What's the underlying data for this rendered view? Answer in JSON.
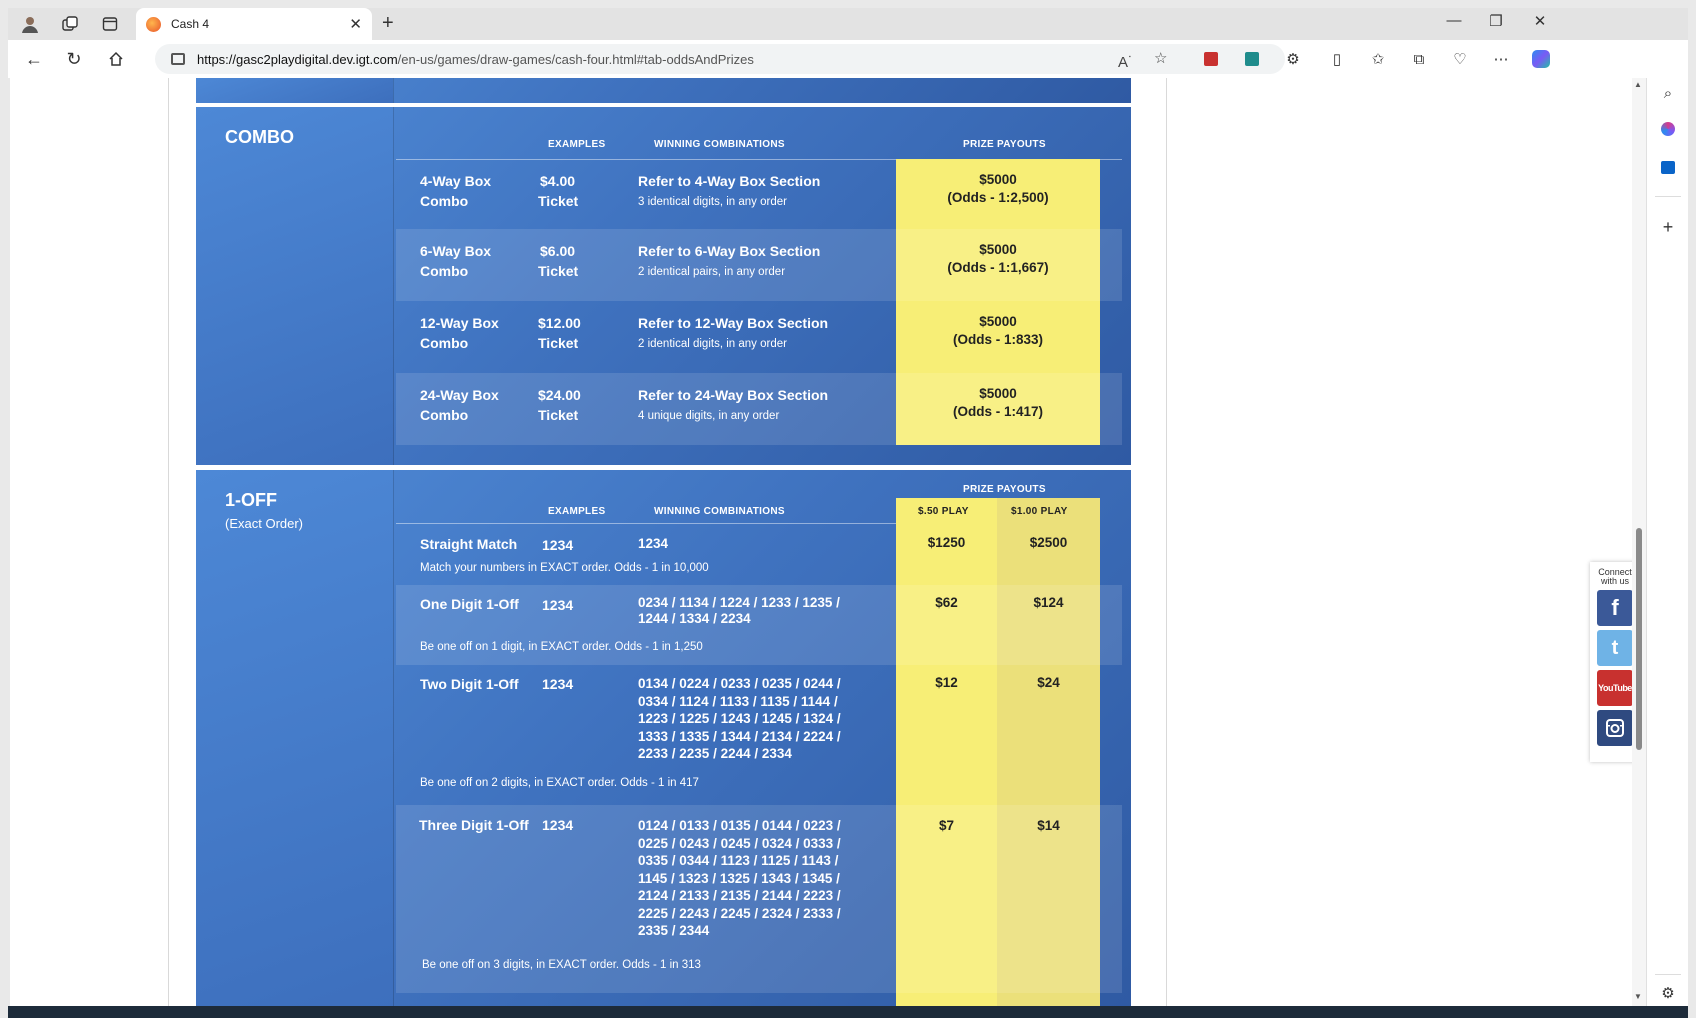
{
  "browser": {
    "tab_title": "Cash 4",
    "url_host": "https://gasc2playdigital.dev.igt.com",
    "url_path": "/en-us/games/draw-games/cash-four.html#tab-oddsAndPrizes"
  },
  "combo": {
    "title": "COMBO",
    "headers": {
      "examples": "EXAMPLES",
      "winning": "WINNING COMBINATIONS",
      "payouts": "PRIZE PAYOUTS"
    },
    "rows": [
      {
        "name1": "4-Way Box",
        "name2": "Combo",
        "ex1": "$4.00",
        "ex2": "Ticket",
        "win": "Refer to 4-Way Box Section",
        "sub": "3 identical digits, in any order",
        "pay1": "$5000",
        "pay2": "(Odds - 1:2,500)"
      },
      {
        "name1": "6-Way Box",
        "name2": "Combo",
        "ex1": "$6.00",
        "ex2": "Ticket",
        "win": "Refer to 6-Way Box Section",
        "sub": "2 identical pairs, in any order",
        "pay1": "$5000",
        "pay2": "(Odds - 1:1,667)"
      },
      {
        "name1": "12-Way Box",
        "name2": "Combo",
        "ex1": "$12.00",
        "ex2": "Ticket",
        "win": "Refer to 12-Way Box Section",
        "sub": "2 identical digits, in any order",
        "pay1": "$5000",
        "pay2": "(Odds - 1:833)"
      },
      {
        "name1": "24-Way Box",
        "name2": "Combo",
        "ex1": "$24.00",
        "ex2": "Ticket",
        "win": "Refer to 24-Way Box Section",
        "sub": "4 unique digits, in any order",
        "pay1": "$5000",
        "pay2": "(Odds - 1:417)"
      }
    ]
  },
  "oneoff": {
    "title": "1-OFF",
    "subtitle": "(Exact Order)",
    "headers": {
      "payouts": "PRIZE PAYOUTS",
      "examples": "EXAMPLES",
      "winning": "WINNING COMBINATIONS",
      "play50": "$.50 PLAY",
      "play100": "$1.00 PLAY"
    },
    "rows": [
      {
        "name": "Straight Match",
        "ex": "1234",
        "win": [
          "1234"
        ],
        "note": "Match your numbers in EXACT order. Odds - 1 in 10,000",
        "p50": "$1250",
        "p100": "$2500"
      },
      {
        "name": "One Digit 1-Off",
        "ex": "1234",
        "win": [
          "0234 / 1134 / 1224 / 1233 / 1235 /",
          "1244 / 1334 / 2234"
        ],
        "note": "Be one off on 1 digit, in EXACT order. Odds - 1 in 1,250",
        "p50": "$62",
        "p100": "$124"
      },
      {
        "name": "Two Digit 1-Off",
        "ex": "1234",
        "win": [
          "0134 / 0224 / 0233 / 0235 / 0244 /",
          "0334 / 1124 / 1133 / 1135 / 1144 /",
          "1223 / 1225 / 1243 / 1245 / 1324 /",
          "1333 / 1335 / 1344 / 2134 / 2224 /",
          "2233 / 2235 / 2244 / 2334"
        ],
        "note": "Be one off on 2 digits, in EXACT order. Odds - 1 in 417",
        "p50": "$12",
        "p100": "$24"
      },
      {
        "name": "Three Digit 1-Off",
        "ex": "1234",
        "win": [
          "0124 / 0133 / 0135 / 0144 / 0223 /",
          "0225 / 0243 / 0245 / 0324 / 0333 /",
          "0335 / 0344 / 1123 / 1125 / 1143 /",
          "1145 / 1323 / 1325 / 1343 / 1345 /",
          "2124 / 2133 / 2135 / 2144 / 2223 /",
          "2225 / 2243 / 2245 / 2324 / 2333 /",
          "2335 / 2344"
        ],
        "note": "Be one off on 3 digits, in EXACT order. Odds - 1 in 313",
        "p50": "$7",
        "p100": "$14"
      }
    ]
  },
  "social": {
    "caption1": "Connect",
    "caption2": "with us",
    "youtube": "YouTube"
  }
}
